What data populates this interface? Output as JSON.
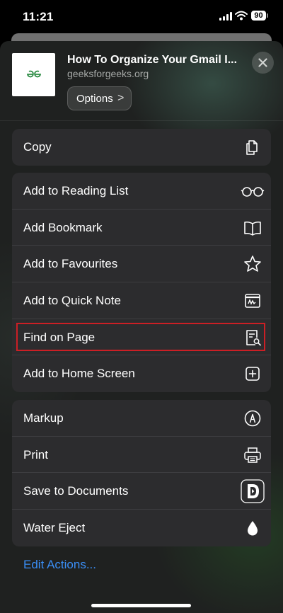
{
  "status_bar": {
    "time": "11:21",
    "battery": "90"
  },
  "header": {
    "title": "How To Organize Your Gmail I...",
    "site": "geeksforgeeks.org",
    "options_label": "Options",
    "options_chevron": ">"
  },
  "groups": [
    {
      "rows": [
        {
          "label": "Copy",
          "icon": "copy-icon"
        }
      ]
    },
    {
      "rows": [
        {
          "label": "Add to Reading List",
          "icon": "glasses-icon"
        },
        {
          "label": "Add Bookmark",
          "icon": "book-icon"
        },
        {
          "label": "Add to Favourites",
          "icon": "star-icon"
        },
        {
          "label": "Add to Quick Note",
          "icon": "quick-note-icon"
        },
        {
          "label": "Find on Page",
          "icon": "find-on-page-icon"
        },
        {
          "label": "Add to Home Screen",
          "icon": "plus-square-icon"
        }
      ]
    },
    {
      "rows": [
        {
          "label": "Markup",
          "icon": "markup-pen-icon"
        },
        {
          "label": "Print",
          "icon": "printer-icon"
        },
        {
          "label": "Save to Documents",
          "icon": "documents-app-icon"
        },
        {
          "label": "Water Eject",
          "icon": "water-drop-icon"
        }
      ]
    }
  ],
  "highlighted_action": "Find on Page",
  "colors": {
    "highlight": "#cc1f25",
    "link": "#3a8ef5",
    "row_bg": "#2c2c2e"
  },
  "edit_actions_label": "Edit Actions..."
}
